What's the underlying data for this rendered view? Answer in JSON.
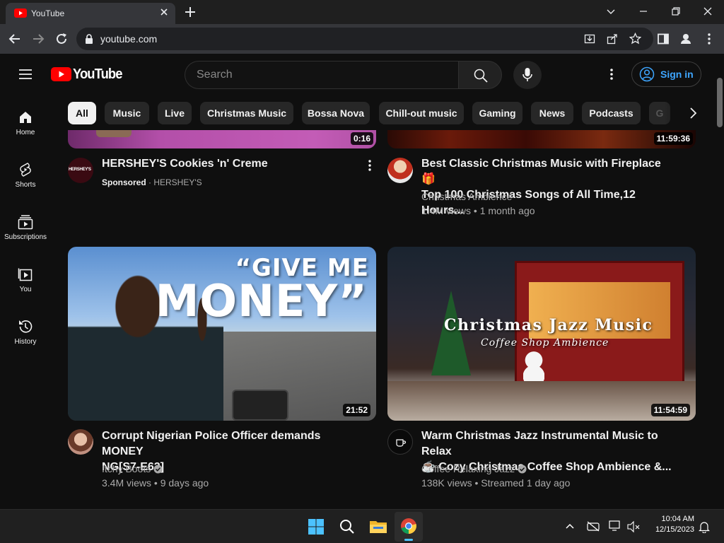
{
  "browser": {
    "tab_title": "YouTube",
    "url": "youtube.com"
  },
  "header": {
    "logo_text": "YouTube",
    "search_placeholder": "Search",
    "signin_label": "Sign in"
  },
  "sidebar": {
    "items": [
      {
        "label": "Home",
        "icon": "home-icon"
      },
      {
        "label": "Shorts",
        "icon": "shorts-icon"
      },
      {
        "label": "Subscriptions",
        "icon": "subscriptions-icon"
      },
      {
        "label": "You",
        "icon": "you-icon"
      },
      {
        "label": "History",
        "icon": "history-icon"
      }
    ]
  },
  "chips": [
    "All",
    "Music",
    "Live",
    "Christmas Music",
    "Bossa Nova",
    "Chill-out music",
    "Gaming",
    "News",
    "Podcasts",
    "G"
  ],
  "videos": [
    {
      "title": "HERSHEY'S Cookies 'n' Creme",
      "sponsored": "Sponsored",
      "channel": "· HERSHEY'S",
      "duration": "0:16",
      "avatar_text": "HERSHEY'S"
    },
    {
      "title_line1": "Best Classic Christmas Music with Fireplace 🎁",
      "title_line2": "Top 100 Christmas Songs of All Time,12 Hours...",
      "channel": "Christmas Ambience",
      "meta": "1.4M views • 1 month ago",
      "duration": "11:59:36"
    },
    {
      "title_line1": "Corrupt Nigerian Police Officer demands MONEY",
      "title_line2": "NG[S7-E62]",
      "channel": "Itchy Boots",
      "meta": "3.4M views • 9 days ago",
      "duration": "21:52",
      "thumb_text_top": "“GIVE ME",
      "thumb_text_bottom": "MONEY”"
    },
    {
      "title_line1": "Warm Christmas Jazz Instrumental Music to Relax",
      "title_line2": "☕ Cozy Christmas Coffee Shop Ambience &...",
      "channel": "Coffee Relaxing Jazz",
      "meta": "138K views • Streamed 1 day ago",
      "duration": "11:54:59",
      "thumb_text_top": "Christmas Jazz Music",
      "thumb_text_bottom": "Coffee Shop Ambience"
    }
  ],
  "taskbar": {
    "time": "10:04 AM",
    "date": "12/15/2023"
  }
}
